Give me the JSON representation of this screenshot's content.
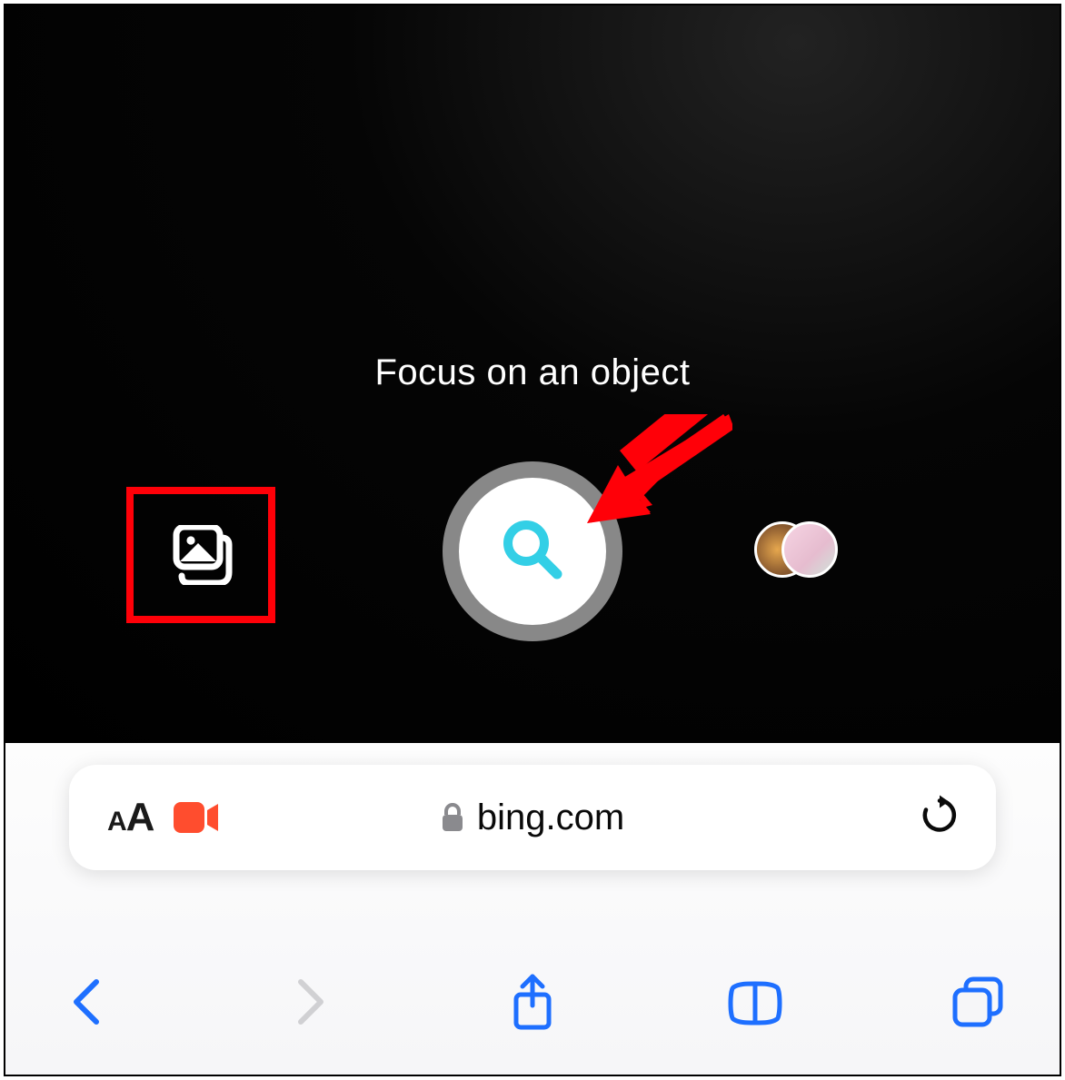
{
  "camera": {
    "hint_text": "Focus on an object",
    "icons": {
      "gallery": "gallery-icon",
      "search": "search-icon",
      "recent": "recent-thumbnails"
    }
  },
  "annotations": {
    "highlight_color": "#ff0008",
    "arrow_color": "#ff0008"
  },
  "browser": {
    "url_display": "bing.com",
    "aa_small": "A",
    "aa_big": "A",
    "recording_color": "#ff4d2e",
    "nav_color": "#1e6fff",
    "back_enabled": true,
    "forward_enabled": false
  }
}
